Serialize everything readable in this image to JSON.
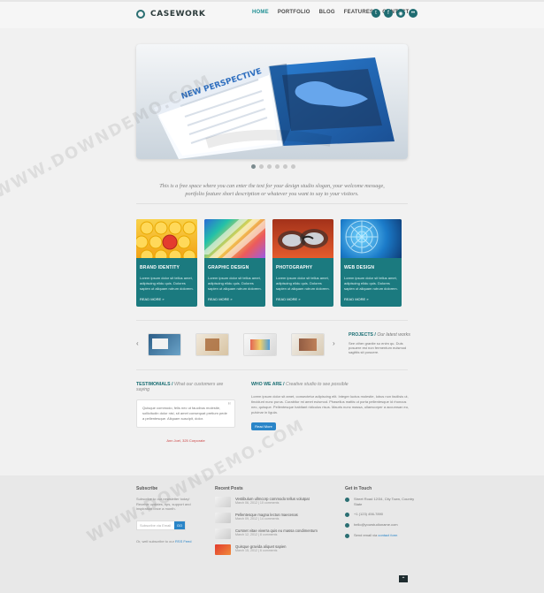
{
  "header": {
    "logo_text": "CASEWORK",
    "nav": [
      {
        "label": "HOME",
        "active": true
      },
      {
        "label": "PORTFOLIO"
      },
      {
        "label": "BLOG"
      },
      {
        "label": "FEATURES"
      },
      {
        "label": "CONTACT"
      }
    ],
    "social": [
      {
        "icon": "twitter-icon",
        "glyph": "t"
      },
      {
        "icon": "facebook-icon",
        "glyph": "f"
      },
      {
        "icon": "rss-icon",
        "glyph": "◉"
      },
      {
        "icon": "flickr-icon",
        "glyph": "••"
      }
    ]
  },
  "hero": {
    "magazine_text": "NEW PERSPECTIVE",
    "slider_dots": 6,
    "active_dot": 0
  },
  "slogan": {
    "line1": "This is a free space where you can enter the text for your design studio slogan, your welcome message,",
    "line2": "portfolio feature short description or whatever you want to say to your visitors."
  },
  "services": [
    {
      "title": "BRAND IDENTITY",
      "text": "Lorem ipsum dolor sit tellus amet, adipiscing elidu quis. Dolores sapien ut aliquam rutrum dolorem.",
      "more": "READ MORE »"
    },
    {
      "title": "GRAPHIC DESIGN",
      "text": "Lorem ipsum dolor sit tellus amet, adipiscing elidu quis. Dolores sapien ut aliquam rutrum dolorem.",
      "more": "READ MORE »"
    },
    {
      "title": "PHOTOGRAPHY",
      "text": "Lorem ipsum dolor sit tellus amet, adipiscing elidu quis. Dolores sapien ut aliquam rutrum dolorem.",
      "more": "READ MORE »"
    },
    {
      "title": "WEB DESIGN",
      "text": "Lorem ipsum dolor sit tellus amet, adipiscing elidu quis. Dolores sapien ut aliquam rutrum dolorem.",
      "more": "READ MORE »"
    }
  ],
  "projects": {
    "title": "PROJECTS",
    "subtitle": "Our latest works",
    "text": "See other granite so enim qu. Duis posuere est non fermentum euismod sagittis sit posuere."
  },
  "testimonials": {
    "title": "TESTIMONIALS",
    "subtitle": "What our customers are saying",
    "quote": "Quisque commodo, felis nec ut faucibus molestie, sollicitudin dolor nisl, sit amet consequat pretium pede a pellentesque. Aliquam suscipit, dolor.",
    "author": "Ann Joel, 325 Corporate"
  },
  "who_we_are": {
    "title": "WHO WE ARE",
    "subtitle": "Creative studio to see possible",
    "text": "Lorem ipsum dolor sit amet, consectetur adipiscing elit. Integer luctus molestie, lobus non facilisis ut, tincidunt nunc purus. Curabitur mi amet euismod. Phasellus mattis ut porta pellentesque id rhoncus nec, quisque. Pellentesque habitant ridiculus risus. Mauris nunc massa, ullamcorper a accumsan eu, pulvinar in ligula.",
    "button": "Read More"
  },
  "footer": {
    "subscribe": {
      "title": "Subscribe",
      "text": "Subscribe to our newsletter today! Receive updates, tips, support and inspiration once a month.",
      "placeholder": "Subscribe via Email",
      "button": "GO",
      "rss_prefix": "Or, well subscribe to our",
      "rss_link": "RSS Feed"
    },
    "recent_posts": {
      "title": "Recent Posts",
      "posts": [
        {
          "title": "Vestibulum ullmcorp commodo tellus volutpat",
          "date": "March 06, 2012 | 10 comments"
        },
        {
          "title": "Pellentesque magna lectus maecenas",
          "date": "March 09, 2012 | 14 comments"
        },
        {
          "title": "Cursnet vitae viverra quis eu massa condimentum",
          "date": "March 12, 2012 | 8 comments"
        },
        {
          "title": "Quisque gravida aliquet sapien",
          "date": "March 15, 2012 | 6 comments"
        }
      ]
    },
    "contact": {
      "title": "Get in Touch",
      "address": "Street Road 12/34, City Town, Country State",
      "phone": "+1 (123) 456-7890",
      "email": "hello@yourstudioname.com",
      "contact_prefix": "Send email via",
      "contact_link": "contact form"
    }
  },
  "watermark": {
    "text1": "WWW.DOWNDEMO.COM",
    "text2": "WWW.DOWNDEMO.COM"
  }
}
